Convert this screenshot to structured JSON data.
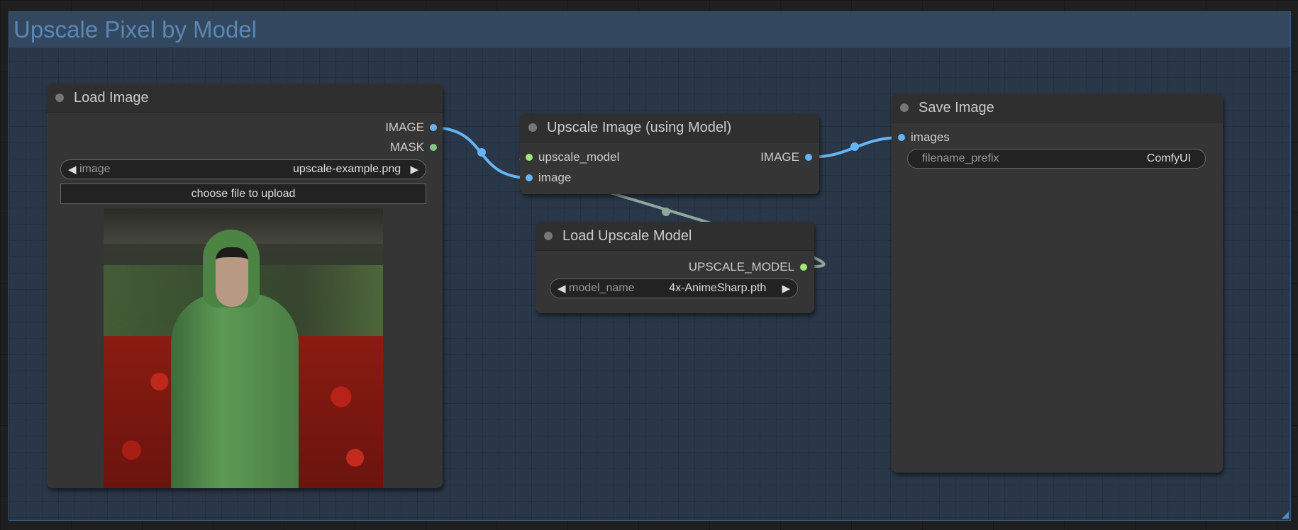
{
  "group": {
    "title": "Upscale Pixel by Model",
    "color": "#33485f"
  },
  "nodes": {
    "load_image": {
      "title": "Load Image",
      "outputs": [
        "IMAGE",
        "MASK"
      ],
      "widget": {
        "label": "image",
        "value": "upscale-example.png"
      },
      "upload_label": "choose file to upload"
    },
    "upscale_image": {
      "title": "Upscale Image (using Model)",
      "inputs": [
        "upscale_model",
        "image"
      ],
      "outputs": [
        "IMAGE"
      ]
    },
    "load_upscale_model": {
      "title": "Load Upscale Model",
      "outputs": [
        "UPSCALE_MODEL"
      ],
      "widget": {
        "label": "model_name",
        "value": "4x-AnimeSharp.pth"
      }
    },
    "save_image": {
      "title": "Save Image",
      "inputs": [
        "images"
      ],
      "widget": {
        "label": "filename_prefix",
        "value": "ComfyUI"
      }
    }
  },
  "colors": {
    "image_type": "#64b5f6",
    "mask_type": "#81c784",
    "upscale_model_type": "#a1e87a",
    "upscale_model_link": "#8fa89a"
  }
}
